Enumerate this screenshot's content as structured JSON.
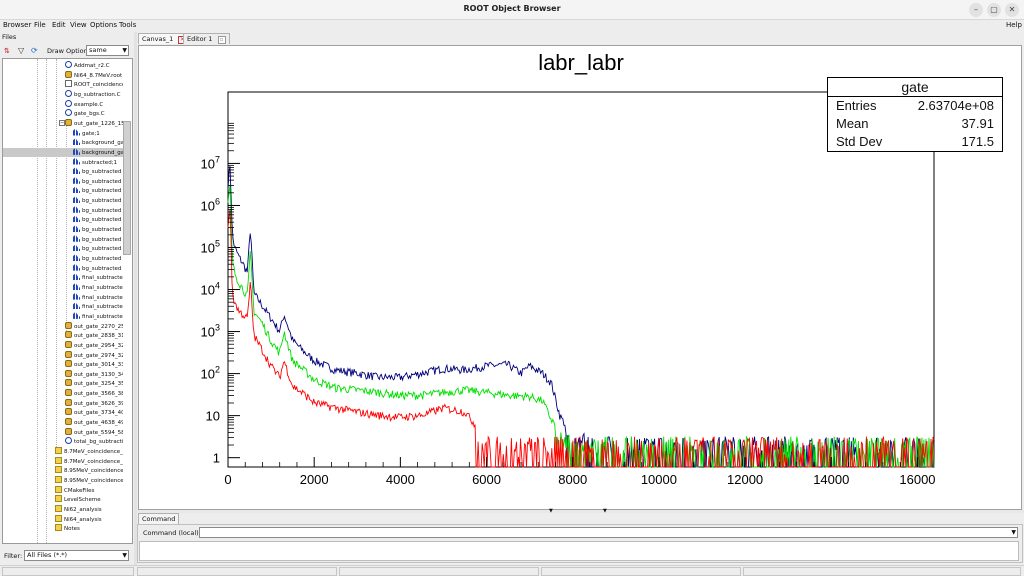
{
  "window": {
    "title": "ROOT Object Browser",
    "controls": [
      "–",
      "▢",
      "✕"
    ]
  },
  "menubar": {
    "left_label": "Browser",
    "items": [
      "File",
      "Edit",
      "View",
      "Options",
      "Tools"
    ],
    "help": "Help"
  },
  "left": {
    "files_tab": "Files",
    "draw_option_label": "Draw Option:",
    "draw_option_value": "same",
    "filter_label": "Filter:",
    "filter_value": "All Files (*.*)",
    "tree_items": [
      {
        "label": "Addmat_r2.C",
        "icon": "root-macro-icon",
        "level": 2
      },
      {
        "label": "Ni64_8.7MeV.root",
        "icon": "root-file-icon",
        "level": 2
      },
      {
        "label": "ROOT_coincidence",
        "icon": "file-icon",
        "level": 2
      },
      {
        "label": "bg_subtraction.C",
        "icon": "root-macro-icon",
        "level": 2
      },
      {
        "label": "example.C",
        "icon": "root-macro-icon",
        "level": 2
      },
      {
        "label": "gate_bgs.C",
        "icon": "root-macro-icon",
        "level": 2
      },
      {
        "label": "out_gate_1226_15",
        "icon": "root-file-icon",
        "level": 2
      },
      {
        "label": "gate;1",
        "icon": "histogram-icon",
        "level": 3
      },
      {
        "label": "background_ga",
        "icon": "histogram-icon",
        "level": 3
      },
      {
        "label": "background_ga",
        "icon": "histogram-icon",
        "level": 3,
        "selected": true
      },
      {
        "label": "subtracted;1",
        "icon": "histogram-icon",
        "level": 3
      },
      {
        "label": "bg_subtracted",
        "icon": "histogram-icon",
        "level": 3
      },
      {
        "label": "bg_subtracted",
        "icon": "histogram-icon",
        "level": 3
      },
      {
        "label": "bg_subtracted",
        "icon": "histogram-icon",
        "level": 3
      },
      {
        "label": "bg_subtracted",
        "icon": "histogram-icon",
        "level": 3
      },
      {
        "label": "bg_subtracted",
        "icon": "histogram-icon",
        "level": 3
      },
      {
        "label": "bg_subtracted",
        "icon": "histogram-icon",
        "level": 3
      },
      {
        "label": "bg_subtracted",
        "icon": "histogram-icon",
        "level": 3
      },
      {
        "label": "bg_subtracted",
        "icon": "histogram-icon",
        "level": 3
      },
      {
        "label": "bg_subtracted",
        "icon": "histogram-icon",
        "level": 3
      },
      {
        "label": "bg_subtracted",
        "icon": "histogram-icon",
        "level": 3
      },
      {
        "label": "bg_subtracted",
        "icon": "histogram-icon",
        "level": 3
      },
      {
        "label": "final_subtracted",
        "icon": "histogram-icon",
        "level": 3
      },
      {
        "label": "final_subtracted",
        "icon": "histogram-icon",
        "level": 3
      },
      {
        "label": "final_subtracted",
        "icon": "histogram-icon",
        "level": 3
      },
      {
        "label": "final_subtracted",
        "icon": "histogram-icon",
        "level": 3
      },
      {
        "label": "final_subtracted",
        "icon": "histogram-icon",
        "level": 3
      },
      {
        "label": "out_gate_2270_25",
        "icon": "root-file-icon",
        "level": 2
      },
      {
        "label": "out_gate_2838_31",
        "icon": "root-file-icon",
        "level": 2
      },
      {
        "label": "out_gate_2954_32",
        "icon": "root-file-icon",
        "level": 2
      },
      {
        "label": "out_gate_2974_32",
        "icon": "root-file-icon",
        "level": 2
      },
      {
        "label": "out_gate_3014_33",
        "icon": "root-file-icon",
        "level": 2
      },
      {
        "label": "out_gate_3130_34",
        "icon": "root-file-icon",
        "level": 2
      },
      {
        "label": "out_gate_3254_35",
        "icon": "root-file-icon",
        "level": 2
      },
      {
        "label": "out_gate_3566_38",
        "icon": "root-file-icon",
        "level": 2
      },
      {
        "label": "out_gate_3626_39",
        "icon": "root-file-icon",
        "level": 2
      },
      {
        "label": "out_gate_3734_40",
        "icon": "root-file-icon",
        "level": 2
      },
      {
        "label": "out_gate_4638_49",
        "icon": "root-file-icon",
        "level": 2
      },
      {
        "label": "out_gate_5594_58",
        "icon": "root-file-icon",
        "level": 2
      },
      {
        "label": "total_bg_subtractio",
        "icon": "root-macro-icon",
        "level": 2
      },
      {
        "label": "8.7MeV_coincidence_a",
        "icon": "folder-icon",
        "level": 1
      },
      {
        "label": "8.7MeV_coincidence_a",
        "icon": "folder-icon",
        "level": 1
      },
      {
        "label": "8.95MeV_coincidence_",
        "icon": "folder-icon",
        "level": 1
      },
      {
        "label": "8.95MeV_coincidence_",
        "icon": "folder-icon",
        "level": 1
      },
      {
        "label": "CMakeFiles",
        "icon": "folder-icon",
        "level": 1
      },
      {
        "label": "LevelScheme",
        "icon": "folder-icon",
        "level": 1
      },
      {
        "label": "Ni62_analysis",
        "icon": "folder-icon",
        "level": 1
      },
      {
        "label": "Ni64_analysis",
        "icon": "folder-icon",
        "level": 1
      },
      {
        "label": "Notes",
        "icon": "folder-icon",
        "level": 1
      }
    ]
  },
  "tabs": [
    {
      "label": "Canvas_1",
      "active": true
    },
    {
      "label": "Editor 1",
      "active": false
    }
  ],
  "stats_box": {
    "title": "gate",
    "rows": [
      {
        "label": "Entries",
        "value": "2.63704e+08"
      },
      {
        "label": "Mean",
        "value": "37.91"
      },
      {
        "label": "Std Dev",
        "value": "171.5"
      }
    ]
  },
  "command": {
    "tab": "Command",
    "label": "Command (local):",
    "value": ""
  },
  "colors": {
    "blue": "#00007a",
    "green": "#00e000",
    "red": "#ff0000"
  },
  "chart_data": {
    "type": "line",
    "title": "labr_labr",
    "xlabel": "",
    "ylabel": "",
    "log_y": true,
    "xlim": [
      0,
      16384
    ],
    "ylim": [
      0.6,
      500000000
    ],
    "x_ticks": [
      "0",
      "2000",
      "4000",
      "6000",
      "8000",
      "10000",
      "12000",
      "14000",
      "16000"
    ],
    "y_ticks": [
      {
        "base": "1",
        "exp": ""
      },
      {
        "base": "10",
        "exp": ""
      },
      {
        "base": "10",
        "exp": "2"
      },
      {
        "base": "10",
        "exp": "3"
      },
      {
        "base": "10",
        "exp": "4"
      },
      {
        "base": "10",
        "exp": "5"
      },
      {
        "base": "10",
        "exp": "6"
      },
      {
        "base": "10",
        "exp": "7"
      }
    ],
    "grid": false,
    "series": [
      {
        "color": "#00007a",
        "x": [
          0,
          50,
          100,
          150,
          250,
          350,
          450,
          520,
          600,
          800,
          1000,
          1200,
          1300,
          1500,
          1800,
          2000,
          2500,
          3000,
          3500,
          4000,
          4500,
          5000,
          5500,
          6000,
          6500,
          6800,
          7000,
          7300,
          7500,
          7700,
          8000,
          8500,
          16384
        ],
        "y": [
          3000000,
          10000000,
          200000,
          100000,
          60000,
          40000,
          25000,
          300000,
          8000,
          4000,
          2000,
          1000,
          2500,
          600,
          300,
          200,
          120,
          100,
          80,
          80,
          100,
          130,
          120,
          150,
          160,
          100,
          150,
          100,
          60,
          10,
          3,
          1.5,
          1.2
        ]
      },
      {
        "color": "#00e000",
        "x": [
          0,
          50,
          100,
          150,
          250,
          350,
          450,
          520,
          600,
          800,
          1000,
          1200,
          1300,
          1500,
          1800,
          2000,
          2500,
          3000,
          3500,
          4000,
          4500,
          5000,
          5500,
          6000,
          6500,
          7000,
          7300,
          7500,
          7800,
          8000,
          8500,
          16384
        ],
        "y": [
          1000000,
          3000000,
          50000,
          25000,
          15000,
          10000,
          7000,
          80000,
          3000,
          1500,
          600,
          300,
          1000,
          200,
          110,
          70,
          45,
          40,
          35,
          30,
          30,
          35,
          40,
          35,
          30,
          28,
          22,
          8,
          3,
          1.5,
          1.2,
          1.1
        ]
      },
      {
        "color": "#ff0000",
        "x": [
          0,
          50,
          100,
          150,
          250,
          350,
          450,
          520,
          600,
          800,
          1000,
          1200,
          1300,
          1500,
          1800,
          2000,
          2500,
          3000,
          3500,
          4000,
          4500,
          5000,
          5500,
          5800,
          6000,
          6500,
          7000,
          7500,
          8000,
          8800,
          9000,
          16384
        ],
        "y": [
          300000,
          1000000,
          8000,
          5000,
          3000,
          2500,
          2000,
          15000,
          800,
          350,
          150,
          80,
          200,
          50,
          30,
          20,
          15,
          12,
          10,
          9,
          10,
          15,
          12,
          5,
          2,
          1.5,
          1.3,
          1.2,
          1.2,
          1.1,
          0.8,
          0.8
        ]
      }
    ]
  }
}
